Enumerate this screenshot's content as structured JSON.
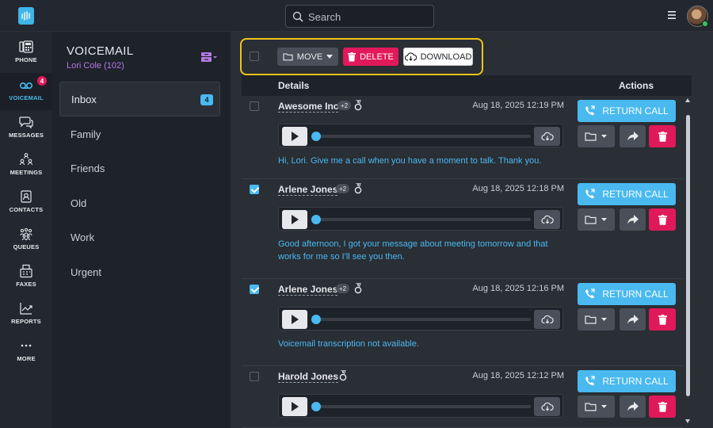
{
  "topbar": {
    "search_placeholder": "Search"
  },
  "nav": [
    {
      "label": "PHONE"
    },
    {
      "label": "VOICEMAIL",
      "badge": "4"
    },
    {
      "label": "MESSAGES"
    },
    {
      "label": "MEETINGS"
    },
    {
      "label": "CONTACTS"
    },
    {
      "label": "QUEUES"
    },
    {
      "label": "FAXES"
    },
    {
      "label": "REPORTS"
    },
    {
      "label": "MORE"
    }
  ],
  "voicemail": {
    "title": "VOICEMAIL",
    "owner": "Lori Cole (102)"
  },
  "folders": [
    {
      "label": "Inbox",
      "badge": "4"
    },
    {
      "label": "Family"
    },
    {
      "label": "Friends"
    },
    {
      "label": "Old"
    },
    {
      "label": "Work"
    },
    {
      "label": "Urgent"
    }
  ],
  "toolbar": {
    "move": "MOVE",
    "delete": "DELETE",
    "download": "DOWNLOAD"
  },
  "table": {
    "details": "Details",
    "actions": "Actions"
  },
  "rows": [
    {
      "caller": "Awesome Inc",
      "plus": "+2",
      "date": "Aug 18, 2025 12:19 PM",
      "transcript": "Hi, Lori. Give me a call when you have a moment to talk. Thank you.",
      "checked": false
    },
    {
      "caller": "Arlene Jones",
      "plus": "+2",
      "date": "Aug 18, 2025 12:18 PM",
      "transcript": "Good afternoon, I got your message about meeting tomorrow and that works for me so I'll see you then.",
      "checked": true
    },
    {
      "caller": "Arlene Jones",
      "plus": "+2",
      "date": "Aug 18, 2025 12:16 PM",
      "transcript": "Voicemail transcription not available.",
      "checked": true
    },
    {
      "caller": "Harold Jones",
      "date": "Aug 18, 2025 12:12 PM",
      "transcript": "",
      "checked": false
    }
  ],
  "return_call": "RETURN CALL",
  "colors": {
    "accent": "#49b9f0",
    "danger": "#e0195a",
    "highlight": "#f0c419",
    "purple": "#b57ae6"
  },
  "icons": [
    "waveform-logo-icon",
    "search-icon",
    "hamburger-menu-icon",
    "phone-icon",
    "voicemail-icon",
    "messages-icon",
    "meetings-icon",
    "contacts-icon",
    "queues-icon",
    "faxes-icon",
    "reports-icon",
    "more-icon",
    "inbox-icon",
    "folder-icon",
    "trash-icon",
    "cloud-download-icon",
    "play-icon",
    "medal-icon",
    "phone-return-icon",
    "forward-icon"
  ]
}
